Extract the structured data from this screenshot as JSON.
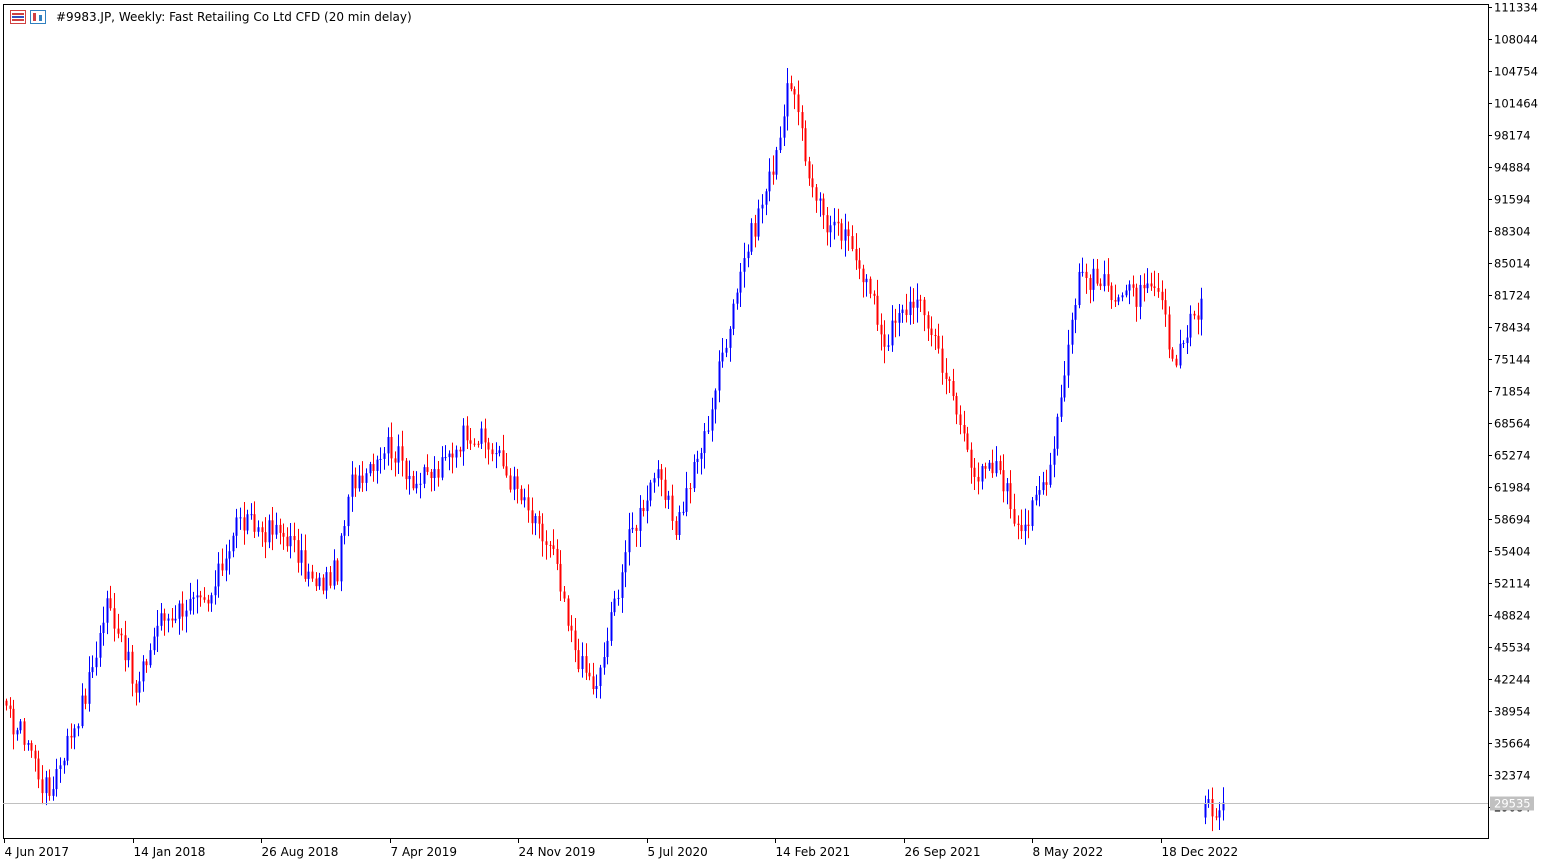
{
  "header": {
    "title": "#9983.JP, Weekly:  Fast Retailing Co Ltd CFD (20 min delay)",
    "icons": [
      "candle-chart-icon",
      "settings-chart-icon"
    ]
  },
  "colors": {
    "bull": "#0000ff",
    "bear": "#ff0000",
    "axis": "#000000",
    "current_line": "#c0c0c0",
    "price_tag_bg": "#c0c0c0",
    "price_tag_text": "#ffffff"
  },
  "chart_data": {
    "type": "candlestick",
    "title": "#9983.JP, Weekly:  Fast Retailing Co Ltd CFD (20 min delay)",
    "ylim": [
      28500,
      111334
    ],
    "y_ticks": [
      "111334",
      "108044",
      "104754",
      "101464",
      "98174",
      "94884",
      "91594",
      "88304",
      "85014",
      "81724",
      "78434",
      "75144",
      "71854",
      "68564",
      "65274",
      "61984",
      "58694",
      "55404",
      "52114",
      "48824",
      "45534",
      "42244",
      "38954",
      "35664",
      "32374",
      "29084"
    ],
    "x_ticks": [
      "4 Jun 2017",
      "14 Jan 2018",
      "26 Aug 2018",
      "7 Apr 2019",
      "24 Nov 2019",
      "5 Jul 2020",
      "14 Feb 2021",
      "26 Sep 2021",
      "8 May 2022",
      "18 Dec 2022"
    ],
    "current_price": "29535",
    "close_path": [
      [
        0,
        38500
      ],
      [
        6,
        36000
      ],
      [
        10,
        31500
      ],
      [
        12,
        30500
      ],
      [
        14,
        33000
      ],
      [
        22,
        40500
      ],
      [
        28,
        50000
      ],
      [
        32,
        47000
      ],
      [
        36,
        40500
      ],
      [
        42,
        48000
      ],
      [
        50,
        50000
      ],
      [
        56,
        49500
      ],
      [
        64,
        58500
      ],
      [
        72,
        57500
      ],
      [
        78,
        57000
      ],
      [
        86,
        51500
      ],
      [
        92,
        53500
      ],
      [
        96,
        62500
      ],
      [
        106,
        66500
      ],
      [
        114,
        62500
      ],
      [
        120,
        63500
      ],
      [
        128,
        68000
      ],
      [
        136,
        65500
      ],
      [
        142,
        61500
      ],
      [
        146,
        58500
      ],
      [
        152,
        55000
      ],
      [
        156,
        47500
      ],
      [
        160,
        43500
      ],
      [
        164,
        41000
      ],
      [
        172,
        55500
      ],
      [
        180,
        63500
      ],
      [
        186,
        58000
      ],
      [
        194,
        67000
      ],
      [
        204,
        84500
      ],
      [
        212,
        93500
      ],
      [
        218,
        104000
      ],
      [
        222,
        95500
      ],
      [
        228,
        89000
      ],
      [
        236,
        86500
      ],
      [
        244,
        77000
      ],
      [
        252,
        81500
      ],
      [
        258,
        77500
      ],
      [
        264,
        69500
      ],
      [
        270,
        63000
      ],
      [
        276,
        64000
      ],
      [
        280,
        59000
      ],
      [
        284,
        58500
      ],
      [
        290,
        64500
      ],
      [
        298,
        84000
      ],
      [
        306,
        82500
      ],
      [
        314,
        81500
      ],
      [
        320,
        82000
      ],
      [
        324,
        75000
      ],
      [
        328,
        78000
      ],
      [
        332,
        81000
      ],
      [
        333,
        29000
      ],
      [
        334,
        28700
      ],
      [
        338,
        29535
      ]
    ]
  }
}
